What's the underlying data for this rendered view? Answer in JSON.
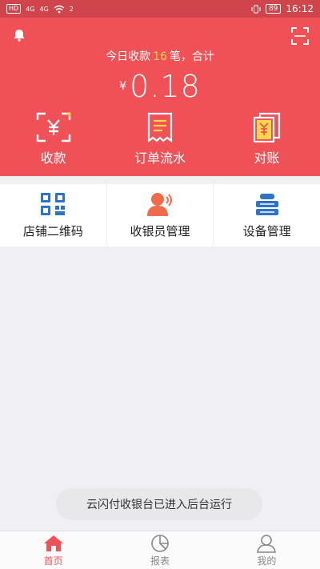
{
  "status_bar": {
    "left_chip": "HD",
    "sig1": "4G",
    "sig2": "4G",
    "wifi_sup": "2",
    "vibrate_icon": "vibrate-icon",
    "battery": "89",
    "time": "16:12"
  },
  "header": {
    "bell_icon": "bell-icon",
    "scan_icon": "scan-icon",
    "today_prefix": "今日收款",
    "today_count": "16",
    "today_suffix": "笔，合计",
    "currency": "¥",
    "amount": "0.18",
    "actions": [
      {
        "label": "收款",
        "icon": "yen-scan-icon"
      },
      {
        "label": "订单流水",
        "icon": "receipt-icon"
      },
      {
        "label": "对账",
        "icon": "reconcile-icon"
      }
    ]
  },
  "menu": [
    {
      "label": "店铺二维码",
      "icon": "qrcode-icon"
    },
    {
      "label": "收银员管理",
      "icon": "cashier-icon"
    },
    {
      "label": "设备管理",
      "icon": "device-icon"
    }
  ],
  "toast": "云闪付收银台已进入后台运行",
  "bottom_nav": [
    {
      "label": "首页",
      "icon": "home-icon",
      "active": true
    },
    {
      "label": "报表",
      "icon": "pie-chart-icon",
      "active": false
    },
    {
      "label": "我的",
      "icon": "user-icon",
      "active": false
    }
  ],
  "colors": {
    "header_red": "#ef5157",
    "status_red": "#d0454c",
    "count_yellow": "#ffd54a",
    "icon_blue": "#2f73c7",
    "icon_orange": "#f06a4c"
  }
}
